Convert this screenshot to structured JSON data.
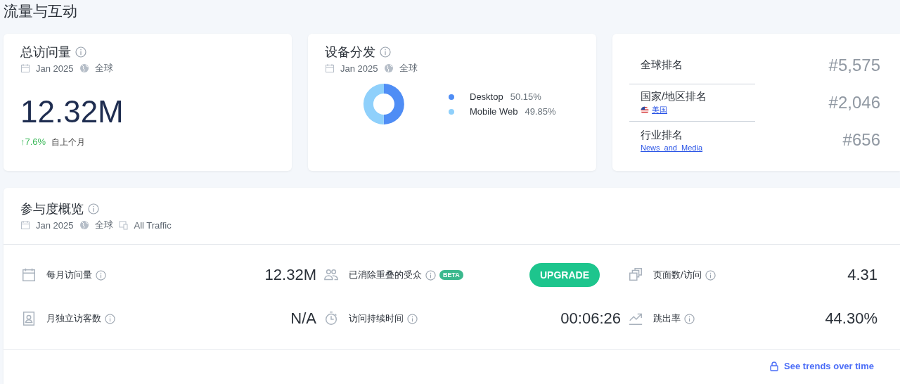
{
  "page_title": "流量与互动",
  "visits_card": {
    "title": "总访问量",
    "date": "Jan 2025",
    "region": "全球",
    "value": "12.32M",
    "change": "↑7.6%",
    "change_up": true,
    "change_note": "自上个月"
  },
  "device_card": {
    "title": "设备分发",
    "date": "Jan 2025",
    "region": "全球",
    "chart_data": {
      "type": "donut",
      "categories": [
        "Desktop",
        "Mobile Web"
      ],
      "values": [
        50.15,
        49.85
      ],
      "legend": "right",
      "colors": [
        "#4f8df5",
        "#8fd0fb"
      ],
      "value_labels": [
        "50.15%",
        "49.85%"
      ]
    }
  },
  "rank_card": {
    "rows": [
      {
        "label": "全球排名",
        "value": "#5,575"
      },
      {
        "label": "国家/地区排名",
        "link": "美国",
        "flag": true,
        "value": "#2,046"
      },
      {
        "label": "行业排名",
        "link": "News_and_Media",
        "flag": false,
        "value": "#656"
      }
    ]
  },
  "engagement": {
    "title": "参与度概览",
    "date": "Jan 2025",
    "region": "全球",
    "traffic": "All Traffic",
    "metrics": [
      {
        "kind": "value",
        "label": "每月访问量",
        "value": "12.32M"
      },
      {
        "kind": "upgrade",
        "label": "已消除重叠的受众",
        "badge": "BETA",
        "button": "UPGRADE"
      },
      {
        "kind": "value",
        "label": "页面数/访问",
        "value": "4.31"
      },
      {
        "kind": "value",
        "label": "月独立访客数",
        "value": "N/A"
      },
      {
        "kind": "value",
        "label": "访问持续时间",
        "value": "00:06:26"
      },
      {
        "kind": "value",
        "label": "跳出率",
        "value": "44.30%"
      }
    ],
    "trends_link": "See trends over time"
  }
}
